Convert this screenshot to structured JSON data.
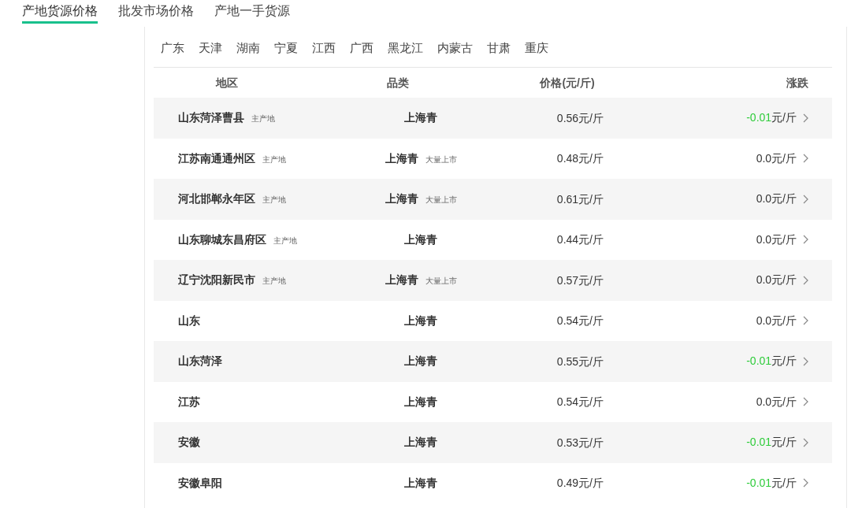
{
  "tabs": [
    {
      "label": "产地货源价格",
      "selected": true
    },
    {
      "label": "批发市场价格",
      "selected": false
    },
    {
      "label": "产地一手货源",
      "selected": false
    }
  ],
  "provinces": [
    "广东",
    "天津",
    "湖南",
    "宁夏",
    "江西",
    "广西",
    "黑龙江",
    "内蒙古",
    "甘肃",
    "重庆"
  ],
  "table": {
    "columns": [
      "地区",
      "品类",
      "价格(元/斤)",
      "涨跌"
    ],
    "rows": [
      {
        "region": "山东菏泽曹县",
        "region_tag": "主产地",
        "category": "上海青",
        "price": "0.56元/斤",
        "change": "-0.01",
        "unit": "元/斤",
        "falling": true
      },
      {
        "region": "江苏南通通州区",
        "region_tag": "主产地",
        "category": "上海青",
        "category_tag": "大量上市",
        "price": "0.48元/斤",
        "change": "0.0",
        "unit": "元/斤",
        "falling": false
      },
      {
        "region": "河北邯郸永年区",
        "region_tag": "主产地",
        "category": "上海青",
        "category_tag": "大量上市",
        "price": "0.61元/斤",
        "change": "0.0",
        "unit": "元/斤",
        "falling": false
      },
      {
        "region": "山东聊城东昌府区",
        "region_tag": "主产地",
        "category": "上海青",
        "price": "0.44元/斤",
        "change": "0.0",
        "unit": "元/斤",
        "falling": false
      },
      {
        "region": "辽宁沈阳新民市",
        "region_tag": "主产地",
        "category": "上海青",
        "category_tag": "大量上市",
        "price": "0.57元/斤",
        "change": "0.0",
        "unit": "元/斤",
        "falling": false
      },
      {
        "region": "山东",
        "category": "上海青",
        "price": "0.54元/斤",
        "change": "0.0",
        "unit": "元/斤",
        "falling": false
      },
      {
        "region": "山东菏泽",
        "category": "上海青",
        "price": "0.55元/斤",
        "change": "-0.01",
        "unit": "元/斤",
        "falling": true
      },
      {
        "region": "江苏",
        "category": "上海青",
        "price": "0.54元/斤",
        "change": "0.0",
        "unit": "元/斤",
        "falling": false
      },
      {
        "region": "安徽",
        "category": "上海青",
        "price": "0.53元/斤",
        "change": "-0.01",
        "unit": "元/斤",
        "falling": true
      },
      {
        "region": "安徽阜阳",
        "category": "上海青",
        "price": "0.49元/斤",
        "change": "-0.01",
        "unit": "元/斤",
        "falling": true
      }
    ]
  }
}
